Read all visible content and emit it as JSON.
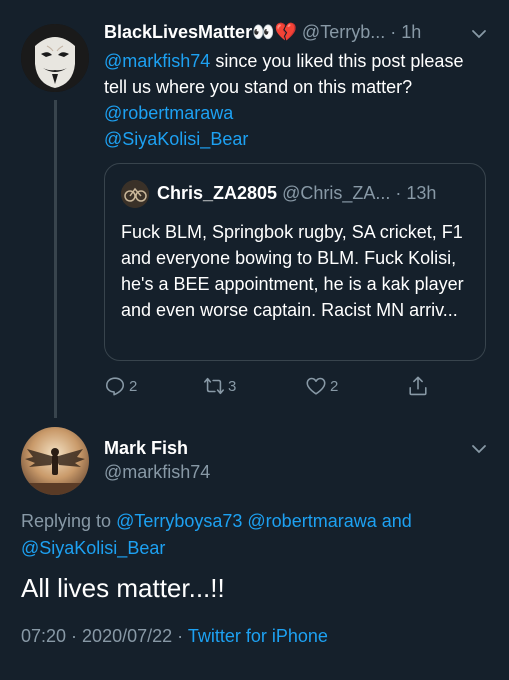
{
  "parent_tweet": {
    "display_name": "BlackLivesMatter",
    "name_emojis": "👀💔",
    "handle": "@Terryb...",
    "separator": "·",
    "time": "1h",
    "text_mention": "@markfish74",
    "text": " since you liked this post please tell us where you stand on this matter? ",
    "mention_2": "@robertmarawa",
    "mention_3": "@SiyaKolisi_Bear"
  },
  "quoted_tweet": {
    "display_name": "Chris_ZA2805",
    "handle": "@Chris_ZA...",
    "separator": "·",
    "time": "13h",
    "text": "Fuck BLM, Springbok rugby, SA cricket, F1 and everyone bowing to BLM. Fuck Kolisi, he's a BEE appointment, he is a kak player and even worse captain. Racist MN arriv..."
  },
  "actions": {
    "reply_count": "2",
    "retweet_count": "3",
    "like_count": "2"
  },
  "reply_tweet": {
    "display_name": "Mark Fish",
    "handle": "@markfish74",
    "replying_prefix": "Replying to ",
    "replying_user_1": "@Terryboysa73",
    "replying_user_2": "@robertmarawa",
    "replying_and": " and",
    "replying_user_3": "@SiyaKolisi_Bear",
    "text": "All lives matter...!!",
    "time": "07:20",
    "date": "2020/07/22",
    "meta_sep_1": " · ",
    "meta_sep_2": " · ",
    "source": "Twitter for iPhone"
  },
  "colors": {
    "background": "#15202b",
    "link": "#1da1f2",
    "secondary": "#8899a6",
    "border": "#38444d"
  },
  "icons": [
    "chevron-down-icon",
    "reply-icon",
    "retweet-icon",
    "like-icon",
    "share-icon"
  ]
}
